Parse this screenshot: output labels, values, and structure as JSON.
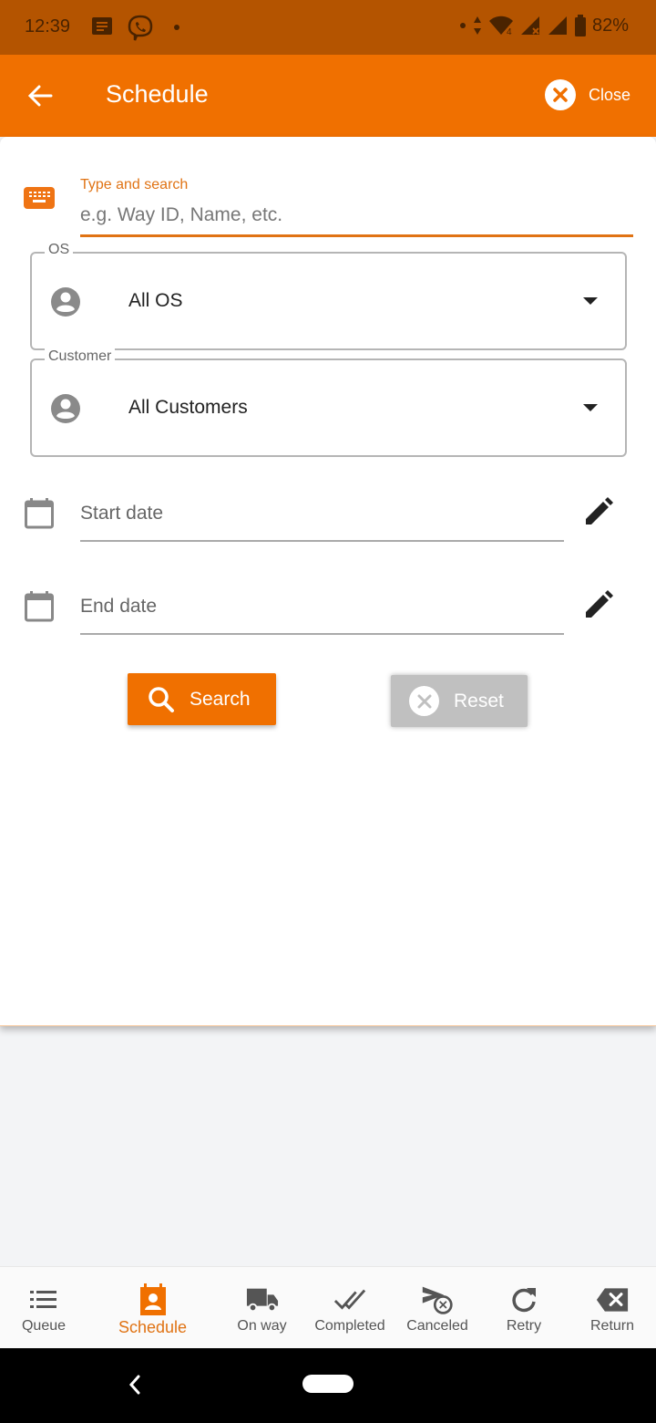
{
  "status_bar": {
    "time": "12:39",
    "battery": "82%",
    "icons": [
      "message-icon",
      "viber-icon",
      "dot-icon",
      "dot-icon",
      "data-arrows-icon",
      "wifi-icon",
      "signal-x-icon",
      "signal-icon",
      "battery-icon"
    ]
  },
  "app_bar": {
    "title": "Schedule",
    "back_icon": "arrow-left-icon",
    "close_label": "Close",
    "close_icon": "close-circle-icon"
  },
  "search": {
    "label": "Type and search",
    "placeholder": "e.g. Way ID, Name, etc.",
    "value": "",
    "icon": "keyboard-icon"
  },
  "filters": {
    "os": {
      "legend": "OS",
      "value": "All OS",
      "icon": "person-circle-icon"
    },
    "customer": {
      "legend": "Customer",
      "value": "All Customers",
      "icon": "person-circle-icon"
    }
  },
  "dates": {
    "start": {
      "placeholder": "Start date",
      "value": ""
    },
    "end": {
      "placeholder": "End date",
      "value": ""
    }
  },
  "buttons": {
    "search_label": "Search",
    "reset_label": "Reset"
  },
  "bottom_nav": {
    "items": [
      {
        "label": "Queue",
        "icon": "list-icon",
        "active": false
      },
      {
        "label": "Schedule",
        "icon": "calendar-person-icon",
        "active": true
      },
      {
        "label": "On way",
        "icon": "truck-icon",
        "active": false
      },
      {
        "label": "Completed",
        "icon": "double-check-icon",
        "active": false
      },
      {
        "label": "Canceled",
        "icon": "cancel-send-icon",
        "active": false
      },
      {
        "label": "Retry",
        "icon": "refresh-icon",
        "active": false
      },
      {
        "label": "Return",
        "icon": "backspace-icon",
        "active": false
      }
    ]
  },
  "colors": {
    "accent": "#f07000",
    "status_bar": "#b45400",
    "reset_button": "#c0c0c0"
  }
}
